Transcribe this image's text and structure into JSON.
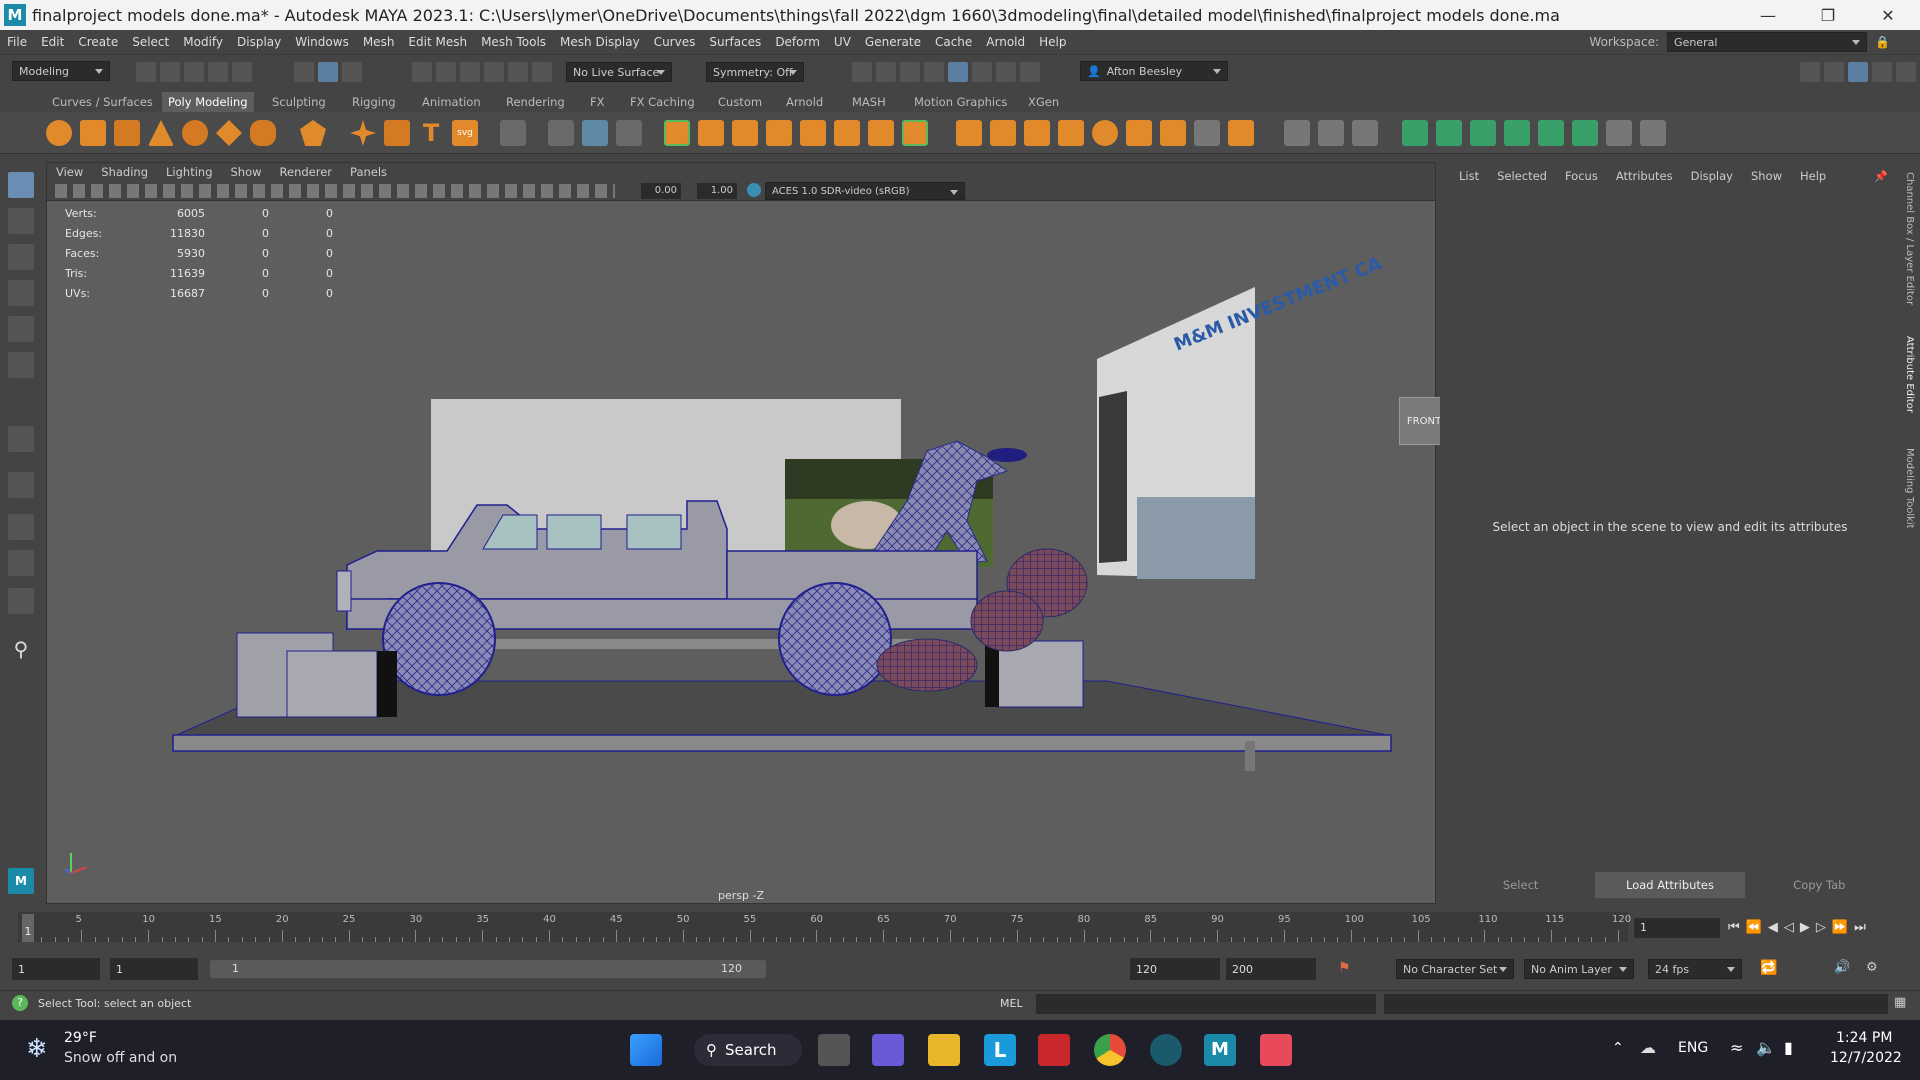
{
  "title_bar": {
    "title": "finalproject models done.ma* - Autodesk MAYA 2023.1: C:\\Users\\lymer\\OneDrive\\Documents\\things\\fall 2022\\dgm 1660\\3dmodeling\\final\\detailed model\\finished\\finalproject models done.ma",
    "logo": "M"
  },
  "menu": [
    "File",
    "Edit",
    "Create",
    "Select",
    "Modify",
    "Display",
    "Windows",
    "Mesh",
    "Edit Mesh",
    "Mesh Tools",
    "Mesh Display",
    "Curves",
    "Surfaces",
    "Deform",
    "UV",
    "Generate",
    "Cache",
    "Arnold",
    "Help"
  ],
  "workspace": {
    "label": "Workspace:",
    "value": "General"
  },
  "status_line": {
    "menu_set": "Modeling",
    "live_surface": "No Live Surface",
    "symmetry": "Symmetry: Off",
    "user": "Afton Beesley"
  },
  "shelf_tabs": [
    "Curves / Surfaces",
    "Poly Modeling",
    "Sculpting",
    "Rigging",
    "Animation",
    "Rendering",
    "FX",
    "FX Caching",
    "Custom",
    "Arnold",
    "MASH",
    "Motion Graphics",
    "XGen"
  ],
  "active_shelf_tab": "Poly Modeling",
  "viewport": {
    "panel_menu": [
      "View",
      "Shading",
      "Lighting",
      "Show",
      "Renderer",
      "Panels"
    ],
    "exposure": "0.00",
    "gamma": "1.00",
    "color_space": "ACES 1.0 SDR-video (sRGB)",
    "hud": [
      {
        "label": "Verts:",
        "value": "6005",
        "a": "0",
        "b": "0"
      },
      {
        "label": "Edges:",
        "value": "11830",
        "a": "0",
        "b": "0"
      },
      {
        "label": "Faces:",
        "value": "5930",
        "a": "0",
        "b": "0"
      },
      {
        "label": "Tris:",
        "value": "11639",
        "a": "0",
        "b": "0"
      },
      {
        "label": "UVs:",
        "value": "16687",
        "a": "0",
        "b": "0"
      }
    ],
    "view_cube": "FRONT",
    "camera": "persp -Z",
    "billboard_text": "M&M INVESTMENT CA"
  },
  "attribute_panel": {
    "menu": [
      "List",
      "Selected",
      "Focus",
      "Attributes",
      "Display",
      "Show",
      "Help"
    ],
    "message": "Select an object in the scene to view and edit its attributes",
    "buttons": [
      "Select",
      "Load Attributes",
      "Copy Tab"
    ]
  },
  "side_tabs": [
    "Channel Box / Layer Editor",
    "Attribute Editor",
    "Modeling Toolkit"
  ],
  "timeline": {
    "ticks": [
      "5",
      "10",
      "15",
      "20",
      "25",
      "30",
      "35",
      "40",
      "45",
      "50",
      "55",
      "60",
      "65",
      "70",
      "75",
      "80",
      "85",
      "90",
      "95",
      "100",
      "105",
      "110",
      "115",
      "120"
    ],
    "current_frame": "1",
    "current_field": "1"
  },
  "range": {
    "start": "1",
    "anim_start": "1",
    "slider_start": "1",
    "slider_end": "120",
    "end": "120",
    "anim_end": "200",
    "character_set": "No Character Set",
    "anim_layer": "No Anim Layer",
    "fps": "24 fps"
  },
  "command_line": {
    "help": "Select Tool: select an object",
    "lang": "MEL"
  },
  "taskbar": {
    "weather_temp": "29°F",
    "weather_desc": "Snow off and on",
    "search": "Search",
    "lang": "ENG",
    "time": "1:24 PM",
    "date": "12/7/2022"
  }
}
